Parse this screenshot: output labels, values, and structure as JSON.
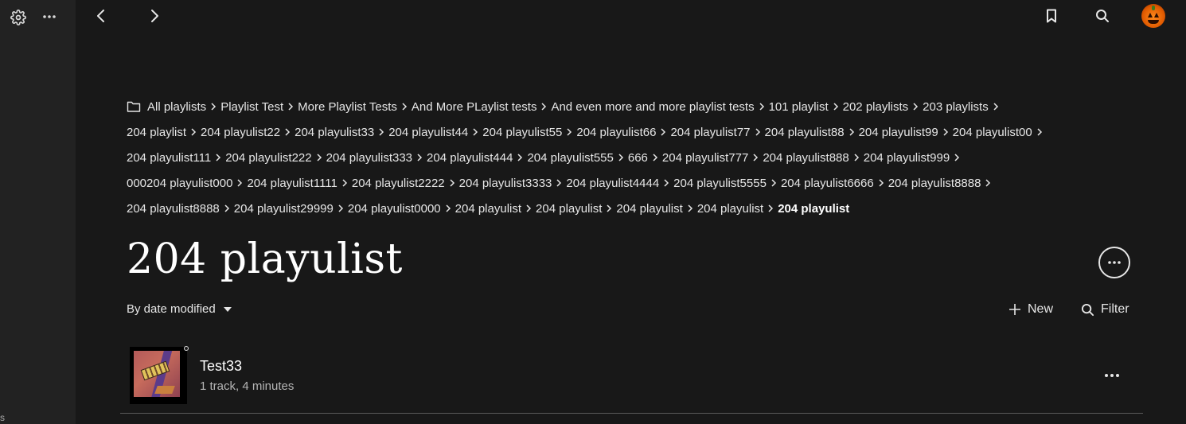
{
  "sidebar": {
    "settings_icon": "gear-icon",
    "more_icon": "more-horizontal-icon",
    "fragment_text": "s"
  },
  "topbar": {
    "back_icon": "chevron-left-icon",
    "forward_icon": "chevron-right-icon",
    "bookmark_icon": "bookmark-icon",
    "search_icon": "search-icon",
    "avatar_icon": "jack-o-lantern-avatar"
  },
  "breadcrumb": {
    "folder_icon": "folder-icon",
    "lines": [
      [
        "All playlists",
        "Playlist Test",
        "More Playlist Tests",
        "And More PLaylist tests",
        "And even more and more playlist tests",
        "101 playlist",
        "202 playlists",
        "203 playlists"
      ],
      [
        "204 playlist",
        "204 playulist22",
        "204 playulist33",
        "204 playulist44",
        "204 playulist55",
        "204 playulist66",
        "204 playulist77",
        "204 playulist88",
        "204 playulist99",
        "204 playulist00"
      ],
      [
        "204 playulist111",
        "204 playulist222",
        "204 playulist333",
        "204 playulist444",
        "204 playulist555",
        "666",
        "204 playulist777",
        "204 playulist888",
        "204 playulist999"
      ],
      [
        "000204 playulist000",
        "204 playulist1111",
        "204 playulist2222",
        "204 playulist3333",
        "204 playulist4444",
        "204 playulist5555",
        "204 playulist6666",
        "204 playulist8888"
      ],
      [
        "204 playulist8888",
        "204 playulist29999",
        "204 playulist0000",
        "204 playulist",
        "204 playulist",
        "204 playulist",
        "204 playulist"
      ]
    ],
    "current": "204 playulist"
  },
  "page": {
    "title": "204 playulist",
    "more_icon": "more-horizontal-circle-icon",
    "sort_label": "By date modified",
    "new_label": "New",
    "filter_label": "Filter"
  },
  "items": [
    {
      "title": "Test33",
      "subtitle": "1 track, 4 minutes"
    }
  ],
  "colors": {
    "background": "#181818",
    "sidebar": "#222222",
    "text": "#e6e6e6",
    "muted": "#b5b5b5"
  }
}
